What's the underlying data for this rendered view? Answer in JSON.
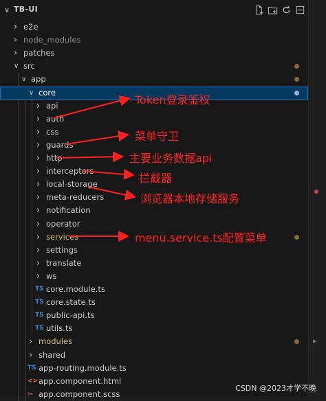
{
  "explorer": {
    "title": "TB-UI",
    "toolbar_icons": [
      "new-file-icon",
      "new-folder-icon",
      "refresh-icon",
      "collapse-all-icon"
    ]
  },
  "tree": [
    {
      "label": "e2e",
      "kind": "folder",
      "expanded": false,
      "depth": 1
    },
    {
      "label": "node_modules",
      "kind": "folder",
      "expanded": false,
      "depth": 1
    },
    {
      "label": "patches",
      "kind": "folder",
      "expanded": false,
      "depth": 1
    },
    {
      "label": "src",
      "kind": "folder",
      "expanded": true,
      "depth": 1
    },
    {
      "label": "app",
      "kind": "folder",
      "expanded": true,
      "depth": 2
    },
    {
      "label": "core",
      "kind": "folder",
      "expanded": true,
      "depth": 3,
      "selected": true
    },
    {
      "label": "api",
      "kind": "folder",
      "expanded": false,
      "depth": 4
    },
    {
      "label": "auth",
      "kind": "folder",
      "expanded": false,
      "depth": 4
    },
    {
      "label": "css",
      "kind": "folder",
      "expanded": false,
      "depth": 4
    },
    {
      "label": "guards",
      "kind": "folder",
      "expanded": false,
      "depth": 4
    },
    {
      "label": "http",
      "kind": "folder",
      "expanded": false,
      "depth": 4
    },
    {
      "label": "interceptors",
      "kind": "folder",
      "expanded": false,
      "depth": 4
    },
    {
      "label": "local-storage",
      "kind": "folder",
      "expanded": false,
      "depth": 4
    },
    {
      "label": "meta-reducers",
      "kind": "folder",
      "expanded": false,
      "depth": 4
    },
    {
      "label": "notification",
      "kind": "folder",
      "expanded": false,
      "depth": 4
    },
    {
      "label": "operator",
      "kind": "folder",
      "expanded": false,
      "depth": 4
    },
    {
      "label": "services",
      "kind": "folder",
      "expanded": false,
      "depth": 4,
      "modified": true
    },
    {
      "label": "settings",
      "kind": "folder",
      "expanded": false,
      "depth": 4
    },
    {
      "label": "translate",
      "kind": "folder",
      "expanded": false,
      "depth": 4
    },
    {
      "label": "ws",
      "kind": "folder",
      "expanded": false,
      "depth": 4
    },
    {
      "label": "core.module.ts",
      "kind": "ts",
      "depth": 4
    },
    {
      "label": "core.state.ts",
      "kind": "ts",
      "depth": 4
    },
    {
      "label": "public-api.ts",
      "kind": "ts",
      "depth": 4
    },
    {
      "label": "utils.ts",
      "kind": "ts",
      "depth": 4
    },
    {
      "label": "modules",
      "kind": "folder",
      "expanded": false,
      "depth": 3,
      "modified": true
    },
    {
      "label": "shared",
      "kind": "folder",
      "expanded": false,
      "depth": 3
    },
    {
      "label": "app-routing.module.ts",
      "kind": "ts",
      "depth": 3
    },
    {
      "label": "app.component.html",
      "kind": "html",
      "depth": 3
    },
    {
      "label": "app.component.scss",
      "kind": "scss",
      "depth": 3
    }
  ],
  "file_icons": {
    "ts": "TS",
    "html": "<>",
    "scss": "✂"
  },
  "annotations": [
    {
      "text": "Token登录鉴权"
    },
    {
      "text": "菜单守卫"
    },
    {
      "text": "主要业务数据api"
    },
    {
      "text": "拦截器"
    },
    {
      "text": "浏览器本地存储服务"
    },
    {
      "text": "menu.service.ts配置菜单"
    }
  ],
  "watermark": "CSDN @2023才学不晚",
  "colors": {
    "selection": "#04395e",
    "accent": "#0078d4",
    "annotation": "#ff2020",
    "modified": "#d7ba7d",
    "ts": "#3b8ed0"
  }
}
